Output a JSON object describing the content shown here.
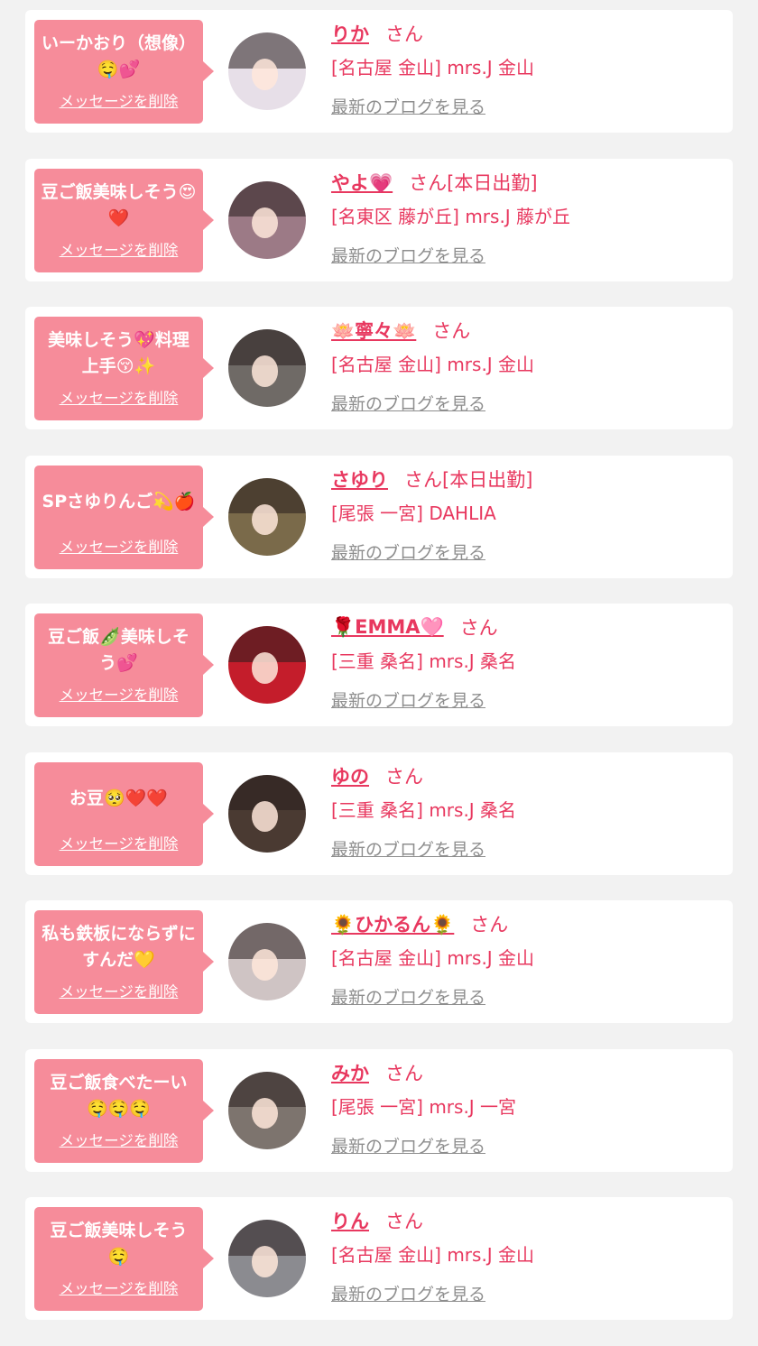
{
  "colors": {
    "page_background": "#f2f2f2",
    "card_background": "#ffffff",
    "bubble": "#f68c9a",
    "accent_text": "#e8385f",
    "link_gray": "#8e8e8e"
  },
  "delete_label": "メッセージを削除",
  "blog_label": "最新のブログを見る",
  "honorific": "さん",
  "entries": [
    {
      "message": "いーかおり（想像）🤤💕",
      "name": "りか",
      "status": "",
      "shop": "[名古屋 金山] mrs.J 金山",
      "avatar": {
        "icon": "avatar-photo",
        "bg": "#e7dfe8"
      }
    },
    {
      "message": "豆ご飯美味しそう😍❤️",
      "name": "やよ💗",
      "status": "[本日出勤]",
      "shop": "[名東区 藤が丘] mrs.J 藤が丘",
      "avatar": {
        "icon": "avatar-photo",
        "bg": "#9c7a86"
      }
    },
    {
      "message": "美味しそう💖料理上手😚✨",
      "name": "🪷寧々🪷",
      "status": "",
      "shop": "[名古屋 金山] mrs.J 金山",
      "avatar": {
        "icon": "avatar-photo",
        "bg": "#6f6a66"
      }
    },
    {
      "message": "SPさゆりんご💫🍎",
      "name": "さゆり",
      "status": "[本日出勤]",
      "shop": "[尾張 一宮] DAHLIA",
      "avatar": {
        "icon": "avatar-photo",
        "bg": "#7a6a4a"
      }
    },
    {
      "message": "豆ご飯🫛美味しそう💕",
      "name": "🌹EMMA🩷",
      "status": "",
      "shop": "[三重 桑名] mrs.J 桑名",
      "avatar": {
        "icon": "avatar-photo",
        "bg": "#c41d2b"
      }
    },
    {
      "message": "お豆🥺❤️❤️",
      "name": "ゆの",
      "status": "",
      "shop": "[三重 桑名] mrs.J 桑名",
      "avatar": {
        "icon": "avatar-photo",
        "bg": "#4a3a32"
      }
    },
    {
      "message": "私も鉄板にならずにすんだ💛",
      "name": "🌻ひかるん🌻",
      "status": "",
      "shop": "[名古屋 金山] mrs.J 金山",
      "avatar": {
        "icon": "avatar-photo",
        "bg": "#cfc4c4"
      }
    },
    {
      "message": "豆ご飯食べたーい🤤🤤🤤",
      "name": "みか",
      "status": "",
      "shop": "[尾張 一宮] mrs.J 一宮",
      "avatar": {
        "icon": "avatar-photo",
        "bg": "#7d746e"
      }
    },
    {
      "message": "豆ご飯美味しそう🤤",
      "name": "りん",
      "status": "",
      "shop": "[名古屋 金山] mrs.J 金山",
      "avatar": {
        "icon": "avatar-photo",
        "bg": "#8b8b90"
      }
    }
  ]
}
